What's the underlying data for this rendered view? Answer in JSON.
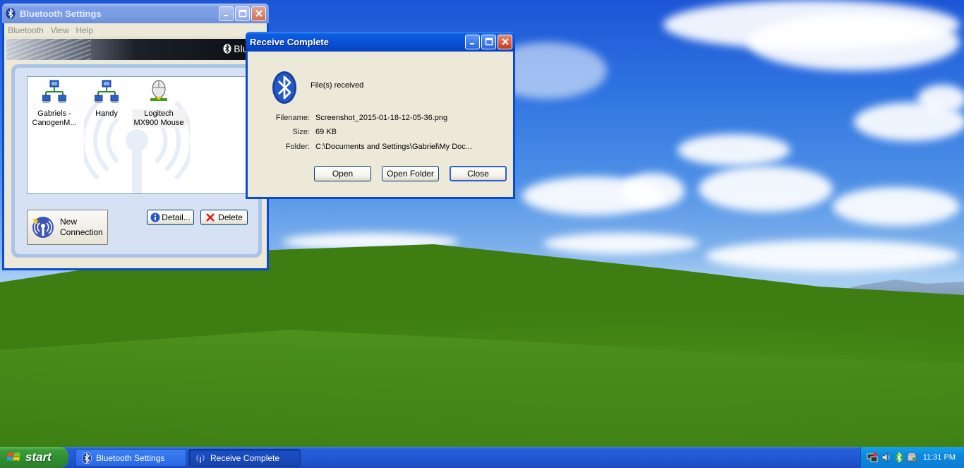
{
  "bt_settings": {
    "title": "Bluetooth Settings",
    "menu": [
      "Bluetooth",
      "View",
      "Help"
    ],
    "banner_logo": "Blueto",
    "devices": [
      {
        "line1": "Gabriels -",
        "line2": "CanogenM..."
      },
      {
        "line1": "Handy",
        "line2": ""
      },
      {
        "line1": "Logitech",
        "line2": "MX900 Mouse"
      }
    ],
    "new_connection_line1": "New",
    "new_connection_line2": "Connection",
    "detail_label": "Detail...",
    "delete_label": "Delete"
  },
  "receive_complete": {
    "title": "Receive Complete",
    "message": "File(s) received",
    "filename_label": "Filename:",
    "filename": "Screenshot_2015-01-18-12-05-36.png",
    "size_label": "Size:",
    "size": "69 KB",
    "folder_label": "Folder:",
    "folder": "C:\\Documents and Settings\\Gabriel\\My Doc...",
    "open_label": "Open",
    "open_folder_label": "Open Folder",
    "close_label": "Close"
  },
  "taskbar": {
    "start_label": "start",
    "items": [
      "Bluetooth Settings",
      "Receive Complete"
    ],
    "clock": "11:31 PM"
  },
  "colors": {
    "title_active": "#0a52d8",
    "title_inactive": "#7b9de4",
    "start_green": "#3c9c3a",
    "taskbar_blue": "#245edc"
  }
}
